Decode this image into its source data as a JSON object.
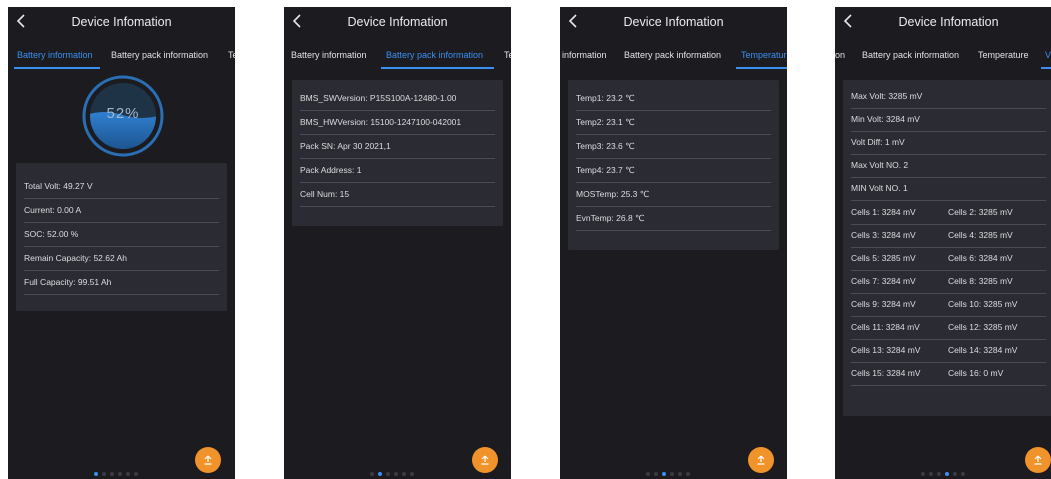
{
  "colors": {
    "accent": "#3a8ff0",
    "fab": "#f0932b",
    "background": "#1c1c20",
    "card": "#2b2c33"
  },
  "screens": [
    {
      "title": "Device Infomation",
      "tabs": [
        "Battery information",
        "Battery pack information",
        "Te"
      ],
      "active_tab": "Battery information",
      "gauge": {
        "label": "52%",
        "level": 0.52
      },
      "rows": [
        "Total Volt: 49.27 V",
        "Current: 0.00 A",
        "SOC: 52.00 %",
        "Remain Capacity: 52.62 Ah",
        "Full Capacity: 99.51 Ah"
      ],
      "page_indicator": {
        "count": 6,
        "active": 0
      }
    },
    {
      "title": "Device Infomation",
      "tabs": [
        "Battery information",
        "Battery pack information",
        "Te"
      ],
      "active_tab": "Battery pack information",
      "rows": [
        "BMS_SWVersion: P15S100A-12480-1.00",
        "BMS_HWVersion: 15100-1247100-042001",
        "Pack SN: Apr 30 2021,1",
        "Pack Address: 1",
        "Cell Num: 15"
      ],
      "page_indicator": {
        "count": 6,
        "active": 1
      }
    },
    {
      "title": "Device Infomation",
      "tabs": [
        "information",
        "Battery pack information",
        "Temperatur"
      ],
      "active_tab": "Temperatur",
      "rows": [
        "Temp1: 23.2 ℃",
        "Temp2: 23.1 ℃",
        "Temp3: 23.6 ℃",
        "Temp4: 23.7 ℃",
        "MOSTemp: 25.3 ℃",
        "EvnTemp: 26.8 ℃"
      ],
      "page_indicator": {
        "count": 6,
        "active": 2
      }
    },
    {
      "title": "Device Infomation",
      "tabs": [
        "on",
        "Battery pack information",
        "Temperature",
        "V"
      ],
      "active_tab": "V",
      "rows": [
        "Max Volt: 3285 mV",
        "Min Volt: 3284 mV",
        "Volt Diff: 1 mV",
        "Max Volt NO. 2",
        "MIN Volt NO. 1"
      ],
      "cell_rows": [
        [
          "Cells 1: 3284 mV",
          "Cells 2: 3285 mV"
        ],
        [
          "Cells 3: 3284 mV",
          "Cells 4: 3285 mV"
        ],
        [
          "Cells 5: 3285 mV",
          "Cells 6: 3284 mV"
        ],
        [
          "Cells 7: 3284 mV",
          "Cells 8: 3285 mV"
        ],
        [
          "Cells 9: 3284 mV",
          "Cells 10: 3285 mV"
        ],
        [
          "Cells 11: 3284 mV",
          "Cells 12: 3285 mV"
        ],
        [
          "Cells 13: 3284 mV",
          "Cells 14: 3284 mV"
        ],
        [
          "Cells 15: 3284 mV",
          "Cells 16: 0 mV"
        ]
      ],
      "page_indicator": {
        "count": 6,
        "active": 3
      }
    }
  ]
}
